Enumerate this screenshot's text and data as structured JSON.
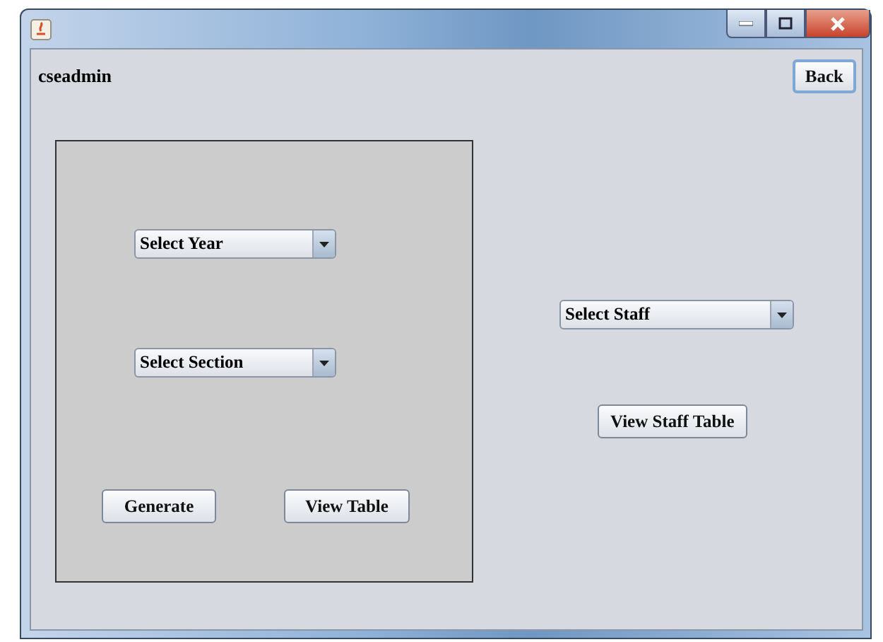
{
  "user": "cseadmin",
  "back_button": "Back",
  "left_panel": {
    "dropdowns": [
      {
        "label": "Select Year"
      },
      {
        "label": "Select Section"
      }
    ],
    "buttons": [
      "Generate",
      "View Table"
    ]
  },
  "right": {
    "dropdown": {
      "label": "Select Staff"
    },
    "button": "View Staff Table"
  }
}
